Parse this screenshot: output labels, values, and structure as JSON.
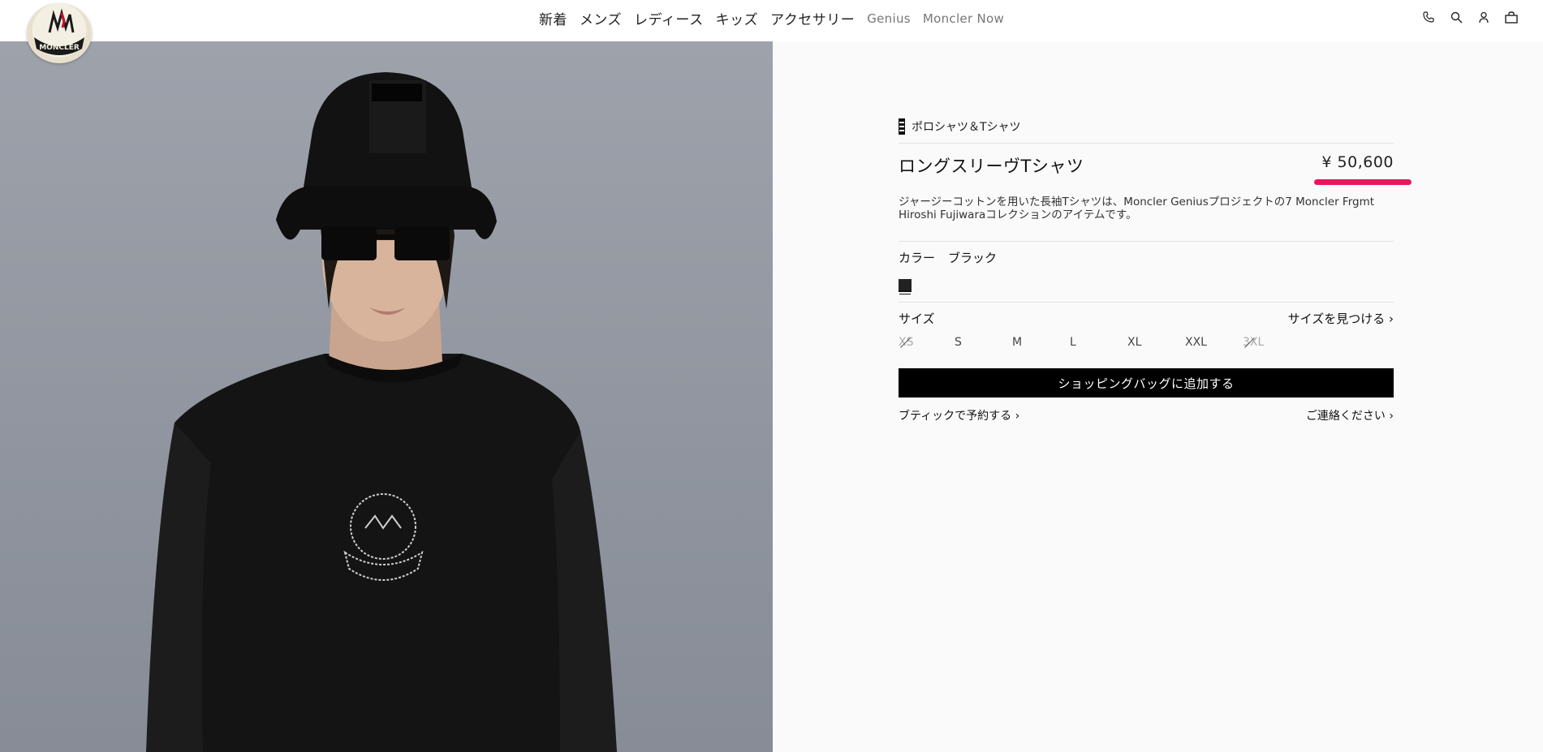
{
  "nav": {
    "items": [
      "新着",
      "メンズ",
      "レディース",
      "キッズ",
      "アクセサリー"
    ],
    "light_items": [
      "Genius",
      "Moncler Now"
    ]
  },
  "logo": {
    "text": "MONCLER"
  },
  "header_icons": [
    "phone-icon",
    "search-icon",
    "account-icon",
    "bag-icon"
  ],
  "product": {
    "breadcrumb": "ポロシャツ＆Tシャツ",
    "title": "ロングスリーヴTシャツ",
    "price": "¥ 50,600",
    "description": "ジャージーコットンを用いた長袖Tシャツは、Moncler Geniusプロジェクトの7 Moncler Frgmt Hiroshi Fujiwaraコレクションのアイテムです。",
    "color_label": "カラー",
    "color_value": "ブラック",
    "size_label": "サイズ",
    "size_finder": "サイズを見つける ›",
    "sizes": [
      {
        "label": "XS",
        "available": false
      },
      {
        "label": "S",
        "available": true
      },
      {
        "label": "M",
        "available": true
      },
      {
        "label": "L",
        "available": true
      },
      {
        "label": "XL",
        "available": true
      },
      {
        "label": "XXL",
        "available": true
      },
      {
        "label": "3XL",
        "available": false
      }
    ],
    "add_to_bag": "ショッピングバッグに追加する",
    "boutique_link": "ブティックで予約する ›",
    "contact_link": "ご連絡ください ›"
  },
  "colors": {
    "accent_underline": "#e8175d",
    "cta_bg": "#000000",
    "swatch": "#222222"
  }
}
